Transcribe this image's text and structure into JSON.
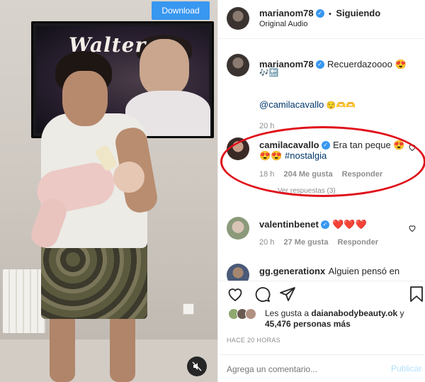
{
  "video": {
    "download_label": "Download",
    "tv_text": "Walter"
  },
  "header": {
    "username": "marianom78",
    "separator": "•",
    "follow_status": "Siguiendo",
    "audio": "Original Audio"
  },
  "comments": [
    {
      "username": "marianom78",
      "text": "Recuerdazoooo 😍",
      "text_line2": "🎶🔙",
      "mention": "@camilacavallo",
      "mention_suffix": "😌🫶🫶",
      "time": "20 h"
    },
    {
      "username": "camilacavallo",
      "text": "Era tan peque 😍",
      "emojis": "😍😍",
      "hashtag": "#nostalgia",
      "time": "18 h",
      "likes": "204 Me gusta",
      "reply": "Responder",
      "view_replies": "Ver respuestas (3)"
    },
    {
      "username": "valentinbenet",
      "text": "❤️❤️❤️",
      "time": "20 h",
      "likes": "27 Me gusta",
      "reply": "Responder"
    },
    {
      "username": "gg.generationx",
      "text": "Alguien pensó en"
    }
  ],
  "likes": {
    "prefix": "Les gusta a ",
    "user": "daianabodybeauty.ok",
    "suffix": " y",
    "count": "45,476 personas más"
  },
  "timestamp": "HACE 20 HORAS",
  "add_comment": {
    "placeholder": "Agrega un comentario...",
    "publish": "Publicar"
  },
  "colors": {
    "accent": "#3897f0",
    "highlight": "#e0101a",
    "link": "#00376b",
    "muted": "#8e8e8e"
  }
}
